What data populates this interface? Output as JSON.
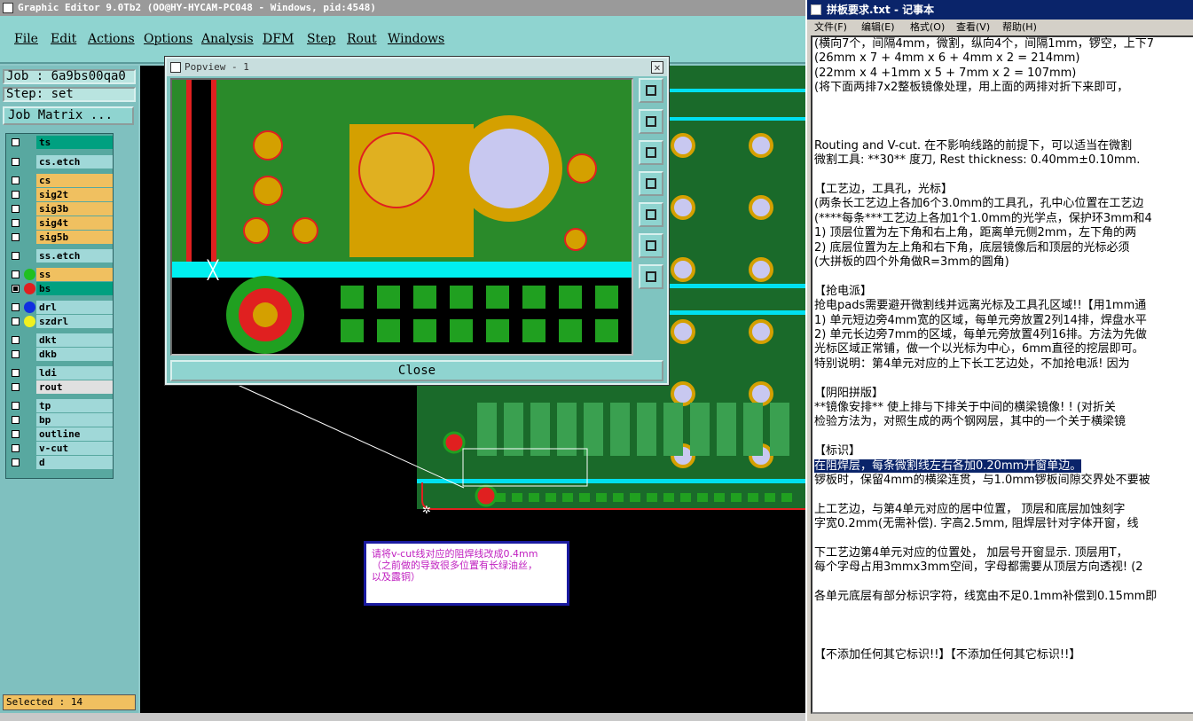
{
  "ge": {
    "title": "Graphic Editor 9.0Tb2 (OO@HY-HYCAM-PC048 - Windows, pid:4548)",
    "menu": [
      "File",
      "Edit",
      "Actions",
      "Options",
      "Analysis",
      "DFM",
      "Step",
      "Rout",
      "Windows"
    ],
    "job": "Job : 6a9bs00qa0",
    "step": "Step: set",
    "job_matrix": "Job Matrix ...",
    "status": "Selected : 14",
    "layers": [
      {
        "name": "ts",
        "color": "#00a080",
        "dot": ""
      },
      {
        "name": "cs.etch",
        "color": "#a0d8d8",
        "dot": ""
      },
      {
        "name": "cs",
        "color": "#f0c060",
        "dot": ""
      },
      {
        "name": "sig2t",
        "color": "#f0c060",
        "dot": ""
      },
      {
        "name": "sig3b",
        "color": "#f0c060",
        "dot": ""
      },
      {
        "name": "sig4t",
        "color": "#f0c060",
        "dot": ""
      },
      {
        "name": "sig5b",
        "color": "#f0c060",
        "dot": ""
      },
      {
        "name": "ss.etch",
        "color": "#a0d8d8",
        "dot": ""
      },
      {
        "name": "ss",
        "color": "#f0c060",
        "dot": "#20c020"
      },
      {
        "name": "bs",
        "color": "#00a080",
        "dot": "#e02020"
      },
      {
        "name": "drl",
        "color": "#a0d8d8",
        "dot": "#1030e0"
      },
      {
        "name": "szdrl",
        "color": "#a0d8d8",
        "dot": "#f0f020"
      },
      {
        "name": "dkt",
        "color": "#a0d8d8",
        "dot": ""
      },
      {
        "name": "dkb",
        "color": "#a0d8d8",
        "dot": ""
      },
      {
        "name": "ldi",
        "color": "#a0d8d8",
        "dot": ""
      },
      {
        "name": "rout",
        "color": "#e0e0e0",
        "dot": ""
      },
      {
        "name": "tp",
        "color": "#a0d8d8",
        "dot": ""
      },
      {
        "name": "bp",
        "color": "#a0d8d8",
        "dot": ""
      },
      {
        "name": "outline",
        "color": "#a0d8d8",
        "dot": ""
      },
      {
        "name": "v-cut",
        "color": "#a0d8d8",
        "dot": ""
      },
      {
        "name": "d",
        "color": "#a0d8d8",
        "dot": ""
      }
    ]
  },
  "popview": {
    "title": "Popview - 1",
    "close_x": "✕",
    "close_button": "Close",
    "tools": [
      "fit-icon",
      "zoom-in-icon",
      "zoom-out-icon",
      "pan-left-icon",
      "pan-right-icon",
      "zoom-box-icon",
      "home-icon"
    ]
  },
  "note": {
    "line1": "请将v-cut线对应的阻焊线改成0.4mm",
    "line2": "（之前做的导致很多位置有长绿油丝，",
    "line3": "以及露铜）"
  },
  "notepad": {
    "title": "拼板要求.txt - 记事本",
    "menu": [
      "文件(F)",
      "编辑(E)",
      "格式(O)",
      "查看(V)",
      "帮助(H)"
    ],
    "lines": [
      "(横向7个，间隔4mm，微割，纵向4个，间隔1mm，锣空，上下7",
      "(26mm x 7 + 4mm x 6 + 4mm x 2 = 214mm)",
      "(22mm x 4 +1mm x 5 + 7mm x 2 = 107mm)",
      "(将下面两排7x2整板镜像处理，用上面的两排对折下来即可，",
      "",
      "",
      "",
      "Routing and V-cut. 在不影响线路的前提下，可以适当在微割",
      "微割工具: **30** 度刀, Rest thickness: 0.40mm±0.10mm.",
      "",
      "【工艺边，工具孔，光标】",
      "(两条长工艺边上各加6个3.0mm的工具孔，孔中心位置在工艺边",
      "(****每条***工艺边上各加1个1.0mm的光学点，保护环3mm和4",
      "1) 顶层位置为左下角和右上角，距离单元侧2mm，左下角的两",
      "2) 底层位置为左上角和右下角，底层镜像后和顶层的光标必须",
      "(大拼板的四个外角做R=3mm的圆角)",
      "",
      "【抢电派】",
      "抢电pads需要避开微割线并远离光标及工具孔区域!!【用1mm通",
      "1) 单元短边旁4mm宽的区域，每单元旁放置2列14排，焊盘水平",
      "2) 单元长边旁7mm的区域，每单元旁放置4列16排。方法为先做",
      "光标区域正常铺，做一个以光标为中心，6mm直径的挖层即可。",
      "特别说明：第4单元对应的上下长工艺边处，不加抢电派! 因为",
      "",
      "【阴阳拼版】",
      "**镜像安排** 使上排与下排关于中间的横梁镜像! ! (对折关",
      "检验方法为，对照生成的两个钢网层，其中的一个关于横梁镜",
      "",
      "【标识】",
      "在阻焊层，每条微割线左右各加0.20mm开窗单边。",
      "锣板时，保留4mm的横梁连贯，与1.0mm锣板间隙交界处不要被",
      "",
      "上工艺边，与第4单元对应的居中位置， 顶层和底层加蚀刻字",
      "字宽0.2mm(无需补偿). 字高2.5mm, 阻焊层针对字体开窗，线",
      "",
      "下工艺边第4单元对应的位置处， 加层号开窗显示. 顶层用T，",
      "每个字母占用3mmx3mm空间，字母都需要从顶层方向透视! (2",
      "",
      "各单元底层有部分标识字符，线宽由不足0.1mm补偿到0.15mm即",
      "",
      "",
      "",
      "【不添加任何其它标识!!】【不添加任何其它标识!!】"
    ]
  }
}
